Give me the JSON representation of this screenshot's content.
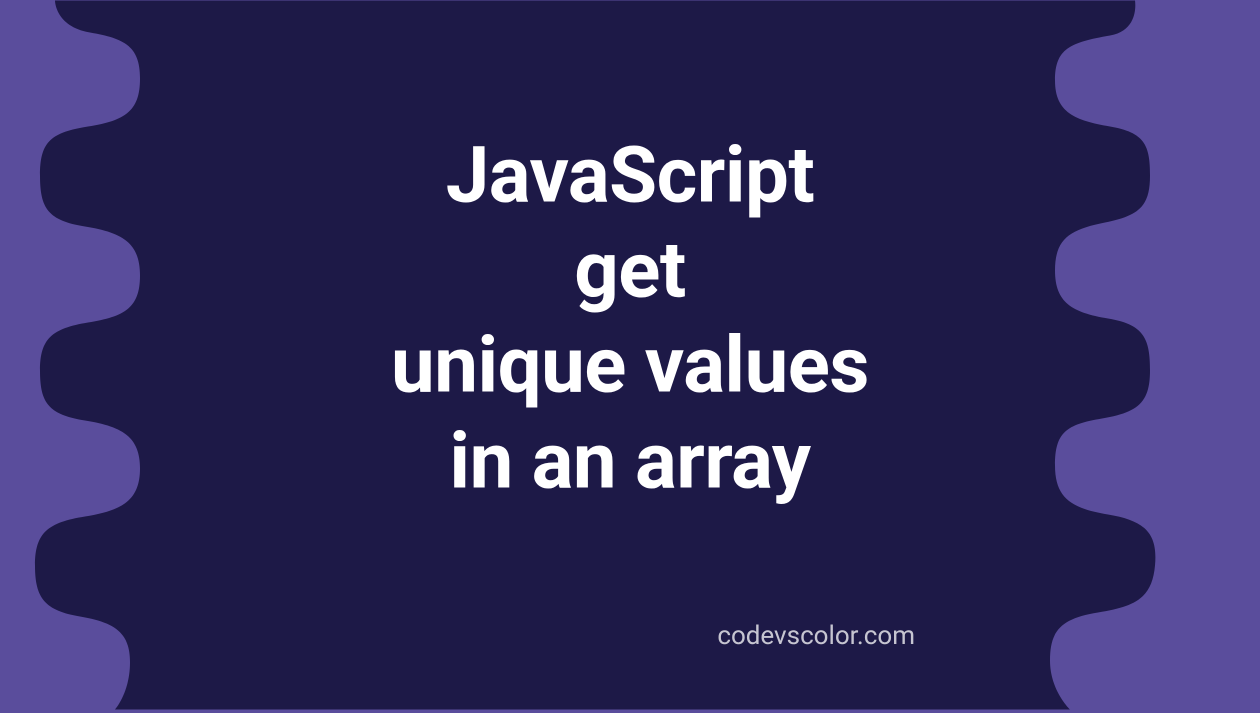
{
  "title": {
    "line1": "JavaScript",
    "line2": "get",
    "line3": "unique values",
    "line4": "in an array"
  },
  "watermark": "codevscolor.com",
  "colors": {
    "background": "#5a4d9c",
    "blob": "#1d1947",
    "text": "#ffffff"
  }
}
